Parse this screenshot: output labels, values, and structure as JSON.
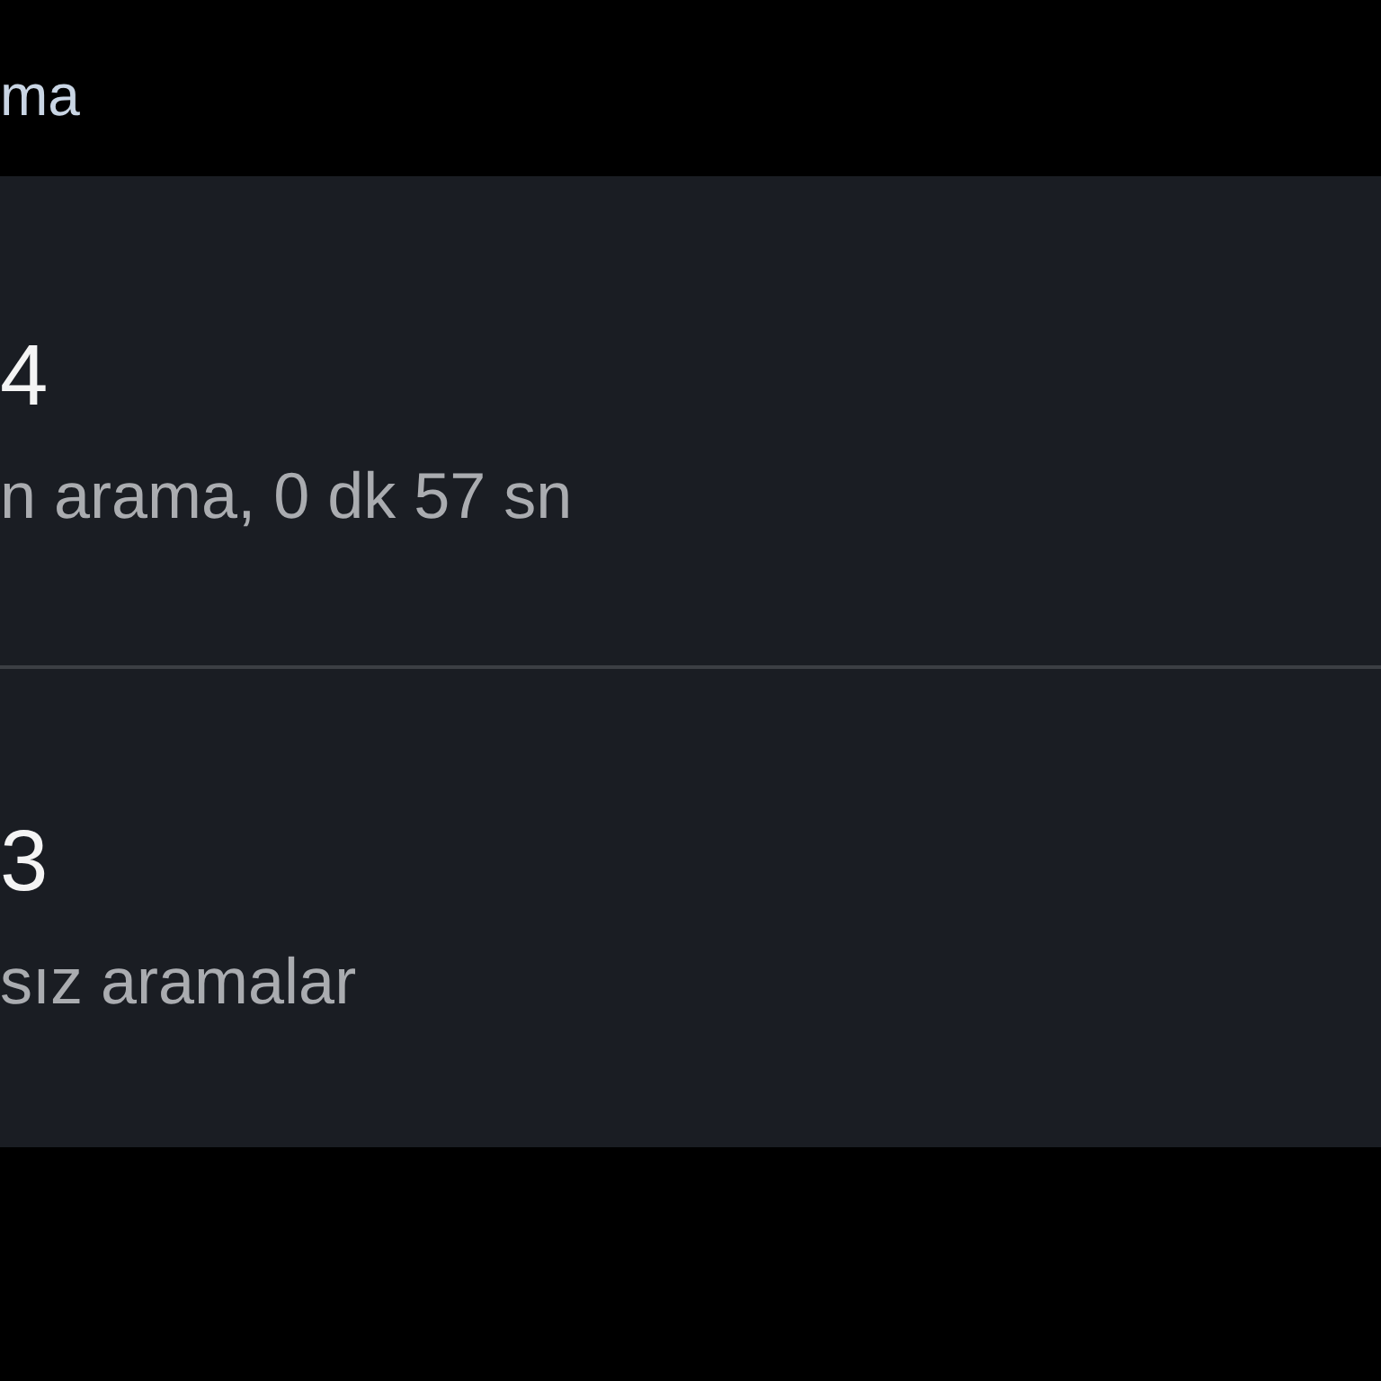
{
  "header": {
    "title": "ma"
  },
  "summary_items": [
    {
      "count": "4",
      "description": "n arama, 0 dk 57 sn"
    },
    {
      "count": "3",
      "description": "sız aramalar"
    }
  ]
}
